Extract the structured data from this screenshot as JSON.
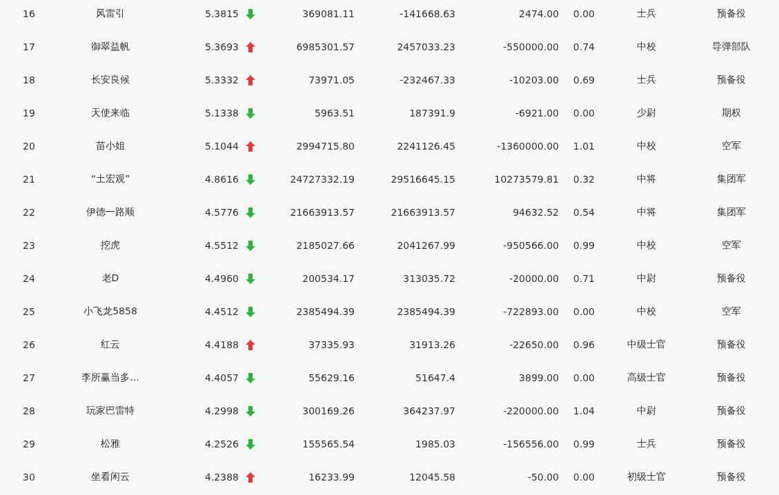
{
  "rows": [
    {
      "rank": "16",
      "name": "风雷引",
      "score": "5.3815",
      "rising": false,
      "column_4": "369081.11",
      "column_5": "-141668.63",
      "column_6": "2474.00",
      "column_7": "0.00",
      "column_8": "士兵",
      "column_9": "预备役"
    },
    {
      "rank": "17",
      "name": "御翠益帆",
      "score": "5.3693",
      "rising": true,
      "column_4": "6985301.57",
      "column_5": "2457033.23",
      "column_6": "-550000.00",
      "column_7": "0.74",
      "column_8": "中校",
      "column_9": "导弹部队"
    },
    {
      "rank": "18",
      "name": "长安良候",
      "score": "5.3332",
      "rising": true,
      "column_4": "73971.05",
      "column_5": "-232467.33",
      "column_6": "-10203.00",
      "column_7": "0.69",
      "column_8": "士兵",
      "column_9": "预备役"
    },
    {
      "rank": "19",
      "name": "天使来临",
      "score": "5.1338",
      "rising": false,
      "column_4": "5963.51",
      "column_5": "187391.9",
      "column_6": "-6921.00",
      "column_7": "0.00",
      "column_8": "少尉",
      "column_9": "期权"
    },
    {
      "rank": "20",
      "name": "苗小姐",
      "score": "5.1044",
      "rising": true,
      "column_4": "2994715.80",
      "column_5": "2241126.45",
      "column_6": "-1360000.00",
      "column_7": "1.01",
      "column_8": "中校",
      "column_9": "空军"
    },
    {
      "rank": "21",
      "name": "“土宏观”",
      "score": "4.8616",
      "rising": false,
      "column_4": "24727332.19",
      "column_5": "29516645.15",
      "column_6": "10273579.81",
      "column_7": "0.32",
      "column_8": "中将",
      "column_9": "集团军"
    },
    {
      "rank": "22",
      "name": "伊德一路顺",
      "score": "4.5776",
      "rising": false,
      "column_4": "21663913.57",
      "column_5": "21663913.57",
      "column_6": "94632.52",
      "column_7": "0.54",
      "column_8": "中将",
      "column_9": "集团军"
    },
    {
      "rank": "23",
      "name": "挖虎",
      "score": "4.5512",
      "rising": false,
      "column_4": "2185027.66",
      "column_5": "2041267.99",
      "column_6": "-950566.00",
      "column_7": "0.99",
      "column_8": "中校",
      "column_9": "空军"
    },
    {
      "rank": "24",
      "name": "老D",
      "score": "4.4960",
      "rising": false,
      "column_4": "200534.17",
      "column_5": "313035.72",
      "column_6": "-20000.00",
      "column_7": "0.71",
      "column_8": "中尉",
      "column_9": "预备役"
    },
    {
      "rank": "25",
      "name": "小飞龙5858",
      "score": "4.4512",
      "rising": false,
      "column_4": "2385494.39",
      "column_5": "2385494.39",
      "column_6": "-722893.00",
      "column_7": "0.00",
      "column_8": "中校",
      "column_9": "空军"
    },
    {
      "rank": "26",
      "name": "红云",
      "score": "4.4188",
      "rising": true,
      "column_4": "37335.93",
      "column_5": "31913.26",
      "column_6": "-22650.00",
      "column_7": "0.96",
      "column_8": "中级士官",
      "column_9": "预备役"
    },
    {
      "rank": "27",
      "name": "李所赢当多...",
      "score": "4.4057",
      "rising": false,
      "column_4": "55629.16",
      "column_5": "51647.4",
      "column_6": "3899.00",
      "column_7": "0.00",
      "column_8": "高级士官",
      "column_9": "预备役"
    },
    {
      "rank": "28",
      "name": "玩家巴雷特",
      "score": "4.2998",
      "rising": false,
      "column_4": "300169.26",
      "column_5": "364237.97",
      "column_6": "-220000.00",
      "column_7": "1.04",
      "column_8": "中尉",
      "column_9": "预备役"
    },
    {
      "rank": "29",
      "name": "松雅",
      "score": "4.2526",
      "rising": false,
      "column_4": "155565.54",
      "column_5": "1985.03",
      "column_6": "-156556.00",
      "column_7": "0.99",
      "column_8": "士兵",
      "column_9": "预备役"
    },
    {
      "rank": "30",
      "name": "坐看闲云",
      "score": "4.2388",
      "rising": true,
      "column_4": "16233.99",
      "column_5": "12045.58",
      "column_6": "-50.00",
      "column_7": "0.00",
      "column_8": "初级士官",
      "column_9": "预备役"
    }
  ]
}
